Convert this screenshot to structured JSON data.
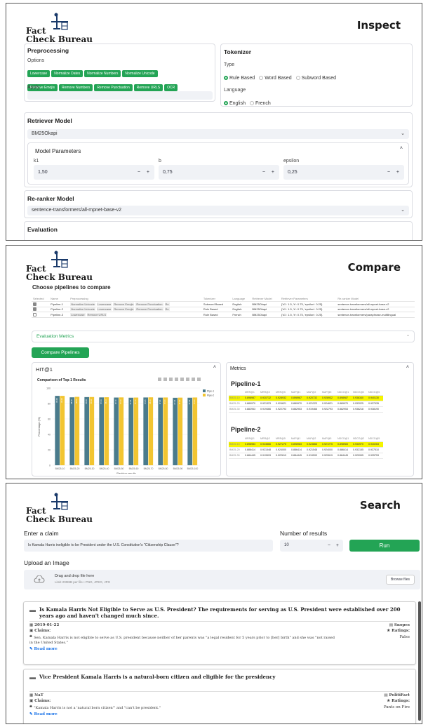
{
  "brand": {
    "line1": "Fact",
    "line2": "Check Bureau"
  },
  "inspect": {
    "title": "Inspect",
    "preprocessing": {
      "title": "Preprocessing",
      "options_label": "Options",
      "apply_label": "Apply",
      "chips_row1": [
        "Lowercase",
        "Normalize Dates",
        "Normalize Numbers",
        "Normalize Unicode"
      ],
      "chips_row2": [
        "Remove Emojis",
        "Remove Numbers",
        "Remove Punctuation",
        "Remove URLS",
        "OCR"
      ]
    },
    "tokenizer": {
      "title": "Tokenizer",
      "type_label": "Type",
      "types": [
        "Rule Based",
        "Word Based",
        "Subword Based"
      ],
      "language_label": "Language",
      "languages": [
        "English",
        "French"
      ]
    },
    "retriever": {
      "title": "Retriever Model",
      "value": "BM25Okapi",
      "params_title": "Model Parameters",
      "params": [
        {
          "label": "k1",
          "value": "1,50"
        },
        {
          "label": "b",
          "value": "0,75"
        },
        {
          "label": "epsilon",
          "value": "0,25"
        }
      ]
    },
    "reranker": {
      "title": "Re-ranker Model",
      "value": "sentence-transformers/all-mpnet-base-v2"
    },
    "evaluation": {
      "title": "Evaluation"
    }
  },
  "compare": {
    "title": "Compare",
    "choose_label": "Choose pipelines to compare",
    "headers": [
      "Selected",
      "Name",
      "Preprocessing",
      "Tokenizer",
      "Language",
      "Retriever Model",
      "Retriever Parameters",
      "Re-ranker Model"
    ],
    "rows": [
      {
        "name": "Pipeline-1",
        "pre": [
          "Normalize Unicode",
          "Lowercase",
          "Remove Emojis",
          "Remove Punctuation",
          "Re"
        ],
        "tok": "Subword Based",
        "lang": "English",
        "ret": "BM25Okapi",
        "params": "{'k1': 1.5, 'b': 0.75, 'epsilon': 0.25}",
        "rr": "sentence-transformers/all-mpnet-base-v2"
      },
      {
        "name": "Pipeline-2",
        "pre": [
          "Normalize Unicode",
          "Lowercase",
          "Remove Emojis",
          "Remove Punctuation",
          "Re"
        ],
        "tok": "Rule Based",
        "lang": "English",
        "ret": "BM25Okapi",
        "params": "{'k1': 1.5, 'b': 0.75, 'epsilon': 0.25}",
        "rr": "sentence-transformers/all-mpnet-base-v2"
      },
      {
        "name": "Pipeline-3",
        "pre": [
          "Lowercase",
          "Remove URLS"
        ],
        "tok": "Rule Based",
        "lang": "French",
        "ret": "BM25Okapi",
        "params": "{'k1': 1.5, 'b': 0.75, 'epsilon': 0.25}",
        "rr": "sentence-transformers/paraphrase-multilingual"
      }
    ],
    "evaluation_metrics": "Evaluation Metrics",
    "compare_button": "Compare Pipelines",
    "hit_title": "HIT@1",
    "metrics_title": "Metrics",
    "metric_headers": [
      "MRR@1",
      "MRR@2",
      "MRR@5",
      "MAP@1",
      "MAP@2",
      "MAP@5",
      "NDCG@1",
      "NDCG@2",
      "NDCG@5"
    ],
    "pipeline1": {
      "title": "Pipeline-1",
      "rows": [
        {
          "name": "BM25-10",
          "values": [
            "0.898987",
            "0.920732",
            "0.928932",
            "0.898987",
            "0.920732",
            "0.928932",
            "0.898987",
            "0.936340",
            "0.940130"
          ],
          "hl": true
        },
        {
          "name": "BM25-20",
          "values": [
            "0.889970",
            "0.921323",
            "0.924621",
            "0.889970",
            "0.921323",
            "0.924621",
            "0.889970",
            "0.932025",
            "0.937935"
          ],
          "hl": false
        },
        {
          "name": "BM25-30",
          "values": [
            "0.882953",
            "0.919466",
            "0.922793",
            "0.882953",
            "0.919466",
            "0.922793",
            "0.882953",
            "0.936218",
            "0.938190"
          ],
          "hl": false
        }
      ]
    },
    "pipeline2": {
      "title": "Pipeline-2",
      "rows": [
        {
          "name": "BM25-10",
          "values": [
            "0.898983",
            "0.923866",
            "0.927275",
            "0.898983",
            "0.923866",
            "0.927275",
            "0.898983",
            "0.933970",
            "0.940263"
          ],
          "hl": true
        },
        {
          "name": "BM25-20",
          "values": [
            "0.886414",
            "0.921548",
            "0.924000",
            "0.886414",
            "0.921548",
            "0.924000",
            "0.886414",
            "0.932155",
            "0.937510"
          ],
          "hl": false
        },
        {
          "name": "BM25-30",
          "values": [
            "0.884445",
            "0.919593",
            "0.922619",
            "0.884445",
            "0.919593",
            "0.922619",
            "0.884445",
            "0.929995",
            "0.935753"
          ],
          "hl": false
        }
      ]
    }
  },
  "chart_data": {
    "type": "bar",
    "title": "Comparison of Top-1 Results",
    "xlabel": "Ranking results",
    "ylabel": "Percentage (%)",
    "categories": [
      "BM25-10",
      "BM25-20",
      "BM25-30",
      "BM25-40",
      "BM25-50",
      "BM25-60",
      "BM25-70",
      "BM25-80",
      "BM25-90",
      "BM25-100"
    ],
    "ylim": [
      0,
      100
    ],
    "series": [
      {
        "name": "Pipe-1",
        "color": "#4a7b8c",
        "values": [
          89.9,
          88.0,
          88.3,
          87.9,
          87.7,
          87.5,
          87.8,
          87.6,
          87.4,
          87.5
        ]
      },
      {
        "name": "Pipe-2",
        "color": "#f2c531",
        "values": [
          89.9,
          88.6,
          88.4,
          88.1,
          87.9,
          87.7,
          88.0,
          87.8,
          87.6,
          87.8
        ]
      }
    ],
    "value_labels": [
      [
        "89.90",
        "88.00",
        "88.35",
        "87.93",
        "87.70",
        "87.55",
        "87.85",
        "87.60",
        "87.44",
        "87.54"
      ],
      [
        "89.90",
        "88.64",
        "88.44",
        "88.10",
        "87.90",
        "87.70",
        "88.00",
        "87.80",
        "87.60",
        "87.80"
      ]
    ],
    "legend": "top-right"
  },
  "search": {
    "title": "Search",
    "claim_label": "Enter a claim",
    "claim_value": "Is Kamala Harris ineligible to be President under the U.S. Constitution's \"Citizenship Clause\"?",
    "num_label": "Number of results",
    "num_value": "10",
    "run_label": "Run",
    "upload_label": "Upload an Image",
    "drop_text": "Drag and drop file here",
    "drop_limit": "Limit 200MB per file • PNG, JPEG, JPG",
    "browse": "Browse files",
    "results": [
      {
        "title": "Is Kamala Harris Not Eligible to Serve as U.S. President? The requirements for serving as U.S. President were established over 200 years ago and haven't changed much since.",
        "date": "2019-01-22",
        "source": "Snopes",
        "claims_label": "Claims:",
        "ratings_label": "Ratings:",
        "claim": "Sen. Kamala Harris is not eligible to serve as U.S. president because neither of her parents was \"a legal resident for 5 years prior to [her] birth\" and she was \"not raised in the United States.\"",
        "rating": "False",
        "more": "Read more"
      },
      {
        "title": "Vice President Kamala Harris is a natural-born citizen and eligible for the presidency",
        "date": "NaT",
        "source": "PolitiFact",
        "claims_label": "Claims:",
        "ratings_label": "Ratings:",
        "claim": "\"Kamala Harris is not a 'natural born citizen'\" and \"can't be president.\"",
        "rating": "Pants on Fire",
        "more": "Read more"
      }
    ]
  }
}
